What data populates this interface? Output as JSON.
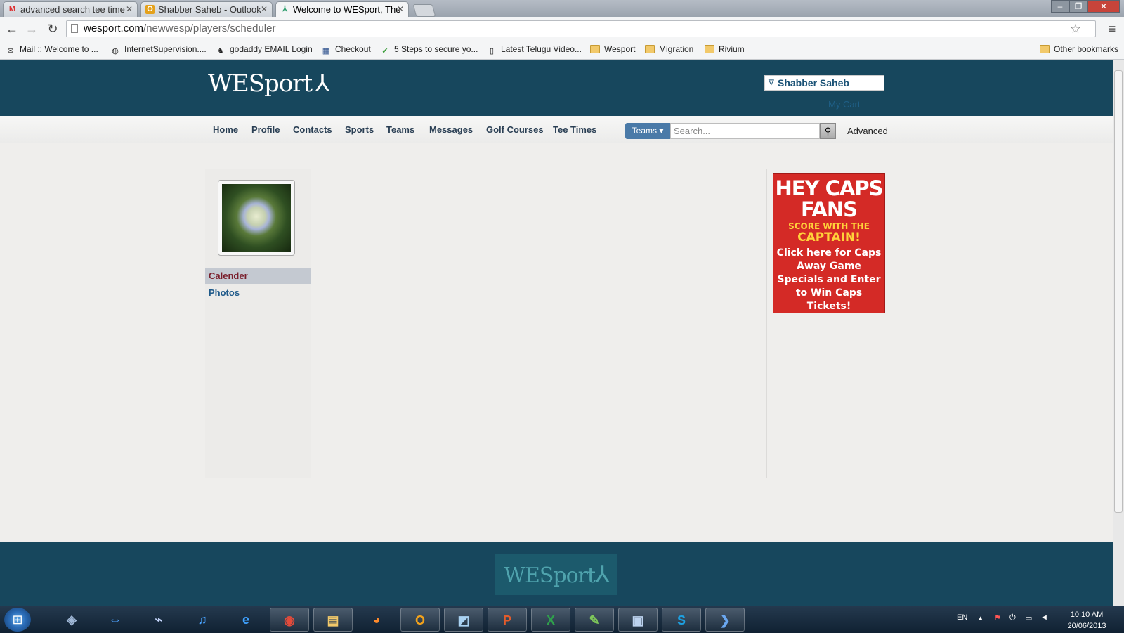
{
  "browser": {
    "tabs": [
      {
        "title": "advanced search tee time",
        "icon": "gmail-icon",
        "active": false
      },
      {
        "title": "Shabber Saheb - Outlook",
        "icon": "outlook-icon",
        "active": false
      },
      {
        "title": "Welcome to WESport, The",
        "icon": "wesport-icon",
        "active": true
      }
    ],
    "url_host": "wesport.com",
    "url_path": "/newwesp/players/scheduler",
    "bookmarks": [
      {
        "label": "Mail :: Welcome to ...",
        "icon": "mail-icon"
      },
      {
        "label": "InternetSupervision....",
        "icon": "globe-icon"
      },
      {
        "label": "godaddy EMAIL Login",
        "icon": "godaddy-icon"
      },
      {
        "label": "Checkout",
        "icon": "grid-icon"
      },
      {
        "label": "5 Steps to secure yo...",
        "icon": "check-icon"
      },
      {
        "label": "Latest Telugu Video...",
        "icon": "page-icon"
      },
      {
        "label": "Wesport",
        "icon": "folder-icon"
      },
      {
        "label": "Migration",
        "icon": "folder-icon"
      },
      {
        "label": "Rivium",
        "icon": "folder-icon"
      }
    ],
    "other_bookmarks": "Other bookmarks"
  },
  "header": {
    "logo_text": "WESport",
    "user_name": "Shabber Saheb",
    "my_cart": "My Cart"
  },
  "nav": {
    "items": [
      "Home",
      "Profile",
      "Contacts",
      "Sports",
      "Teams",
      "Messages",
      "Golf Courses",
      "Tee Times"
    ],
    "search_scope": "Teams",
    "search_placeholder": "Search...",
    "advanced": "Advanced"
  },
  "sidebar": {
    "links": [
      "Calender",
      "Photos"
    ]
  },
  "ad": {
    "line1": "HEY CAPS",
    "line2": "FANS",
    "line3": "SCORE WITH THE",
    "line4": "CAPTAIN!",
    "body": "Click here for Caps Away Game Specials and Enter to Win Caps Tickets!"
  },
  "footer": {
    "logo_text": "WESport"
  },
  "taskbar": {
    "language": "EN",
    "time": "10:10 AM",
    "date": "20/06/2013",
    "apps": [
      "virtualbox-icon",
      "teamviewer-icon",
      "network-icon",
      "headset-icon",
      "ie-icon",
      "chrome-icon",
      "explorer-icon",
      "firefox-icon",
      "outlook-icon",
      "file-icon",
      "powerpoint-icon",
      "excel-icon",
      "notepad-icon",
      "remote-desktop-icon",
      "skype-icon",
      "dev-icon"
    ]
  }
}
